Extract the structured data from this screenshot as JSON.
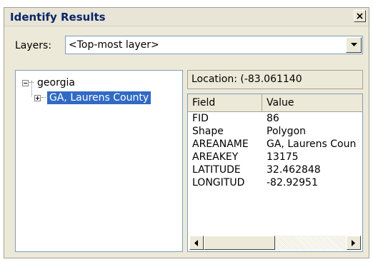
{
  "window": {
    "title": "Identify Results",
    "close_icon": "close-icon"
  },
  "layers": {
    "label": "Layers:",
    "selected": "<Top-most layer>",
    "dropdown_icon": "chevron-down-icon"
  },
  "tree": {
    "root": {
      "label": "georgia",
      "expanded": true,
      "expander_icon": "collapse-minus-icon"
    },
    "child": {
      "label": "GA, Laurens County",
      "selected": true,
      "expander_icon": "expand-plus-icon"
    }
  },
  "location": {
    "text": "Location: (-83.061140"
  },
  "grid": {
    "headers": [
      "Field",
      "Value"
    ],
    "rows": [
      {
        "field": "FID",
        "value": "86"
      },
      {
        "field": "Shape",
        "value": "Polygon"
      },
      {
        "field": "AREANAME",
        "value": "GA, Laurens Coun"
      },
      {
        "field": "AREAKEY",
        "value": "13175"
      },
      {
        "field": "LATITUDE",
        "value": "32.462848"
      },
      {
        "field": "LONGITUD",
        "value": "-82.92951"
      }
    ],
    "scroll_left_icon": "arrow-left-icon",
    "scroll_right_icon": "arrow-right-icon"
  },
  "colors": {
    "title_text": "#0a246a",
    "selection": "#316ac5",
    "window_bg": "#ece9d8"
  }
}
